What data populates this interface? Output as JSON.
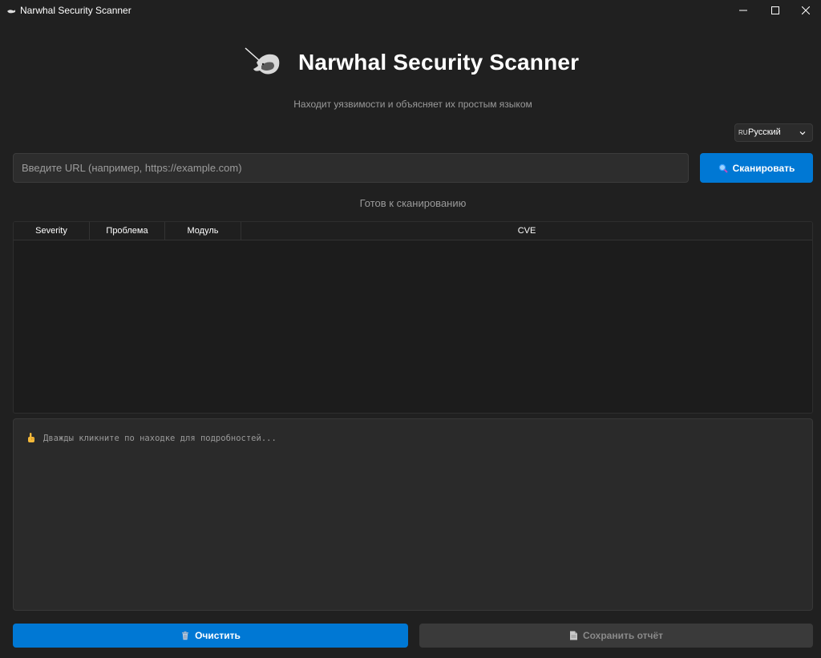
{
  "window": {
    "title": "Narwhal Security Scanner",
    "controls": [
      "minimize-icon",
      "maximize-icon",
      "close-icon"
    ]
  },
  "header": {
    "logo_icon": "narwhal-logo-icon",
    "title": "Narwhal Security Scanner",
    "subtitle": "Находит уязвимости и объясняет их простым языком"
  },
  "language": {
    "flag": "RU",
    "selected": "Русский"
  },
  "scan": {
    "url_placeholder": "Введите URL (например, https://example.com)",
    "url_value": "",
    "button_label": "Сканировать",
    "button_icon": "magnifier-icon"
  },
  "status": {
    "text": "Готов к сканированию"
  },
  "results_table": {
    "columns": [
      "Severity",
      "Проблема",
      "Модуль",
      "CVE"
    ],
    "rows": []
  },
  "details": {
    "hint_icon": "pointing-hand-icon",
    "hint_text": "Дважды кликните по находке для подробностей..."
  },
  "footer": {
    "clear_label": "Очистить",
    "clear_icon": "trash-icon",
    "save_label": "Сохранить отчёт",
    "save_icon": "document-icon"
  },
  "colors": {
    "background": "#202020",
    "accent": "#0078d4",
    "disabled_button": "#3a3a3a",
    "muted_text": "#9a9a9a"
  }
}
